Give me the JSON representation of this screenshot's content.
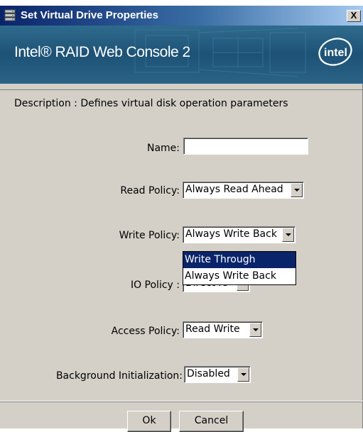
{
  "window": {
    "title": "Set Virtual Drive Properties",
    "close_glyph": "X",
    "icon": "server-stack-icon"
  },
  "banner": {
    "app_name": "Intel® RAID Web Console 2",
    "logo_text": "intel",
    "logo": "intel-logo-icon"
  },
  "description": "Description : Defines virtual disk operation parameters",
  "fields": {
    "name": {
      "label": "Name:",
      "value": ""
    },
    "read_policy": {
      "label": "Read Policy:",
      "value": "Always Read Ahead"
    },
    "write_policy": {
      "label": "Write Policy:",
      "value": "Always Write Back"
    },
    "io_policy": {
      "label": "IO Policy :",
      "value": "Direct IO"
    },
    "access_policy": {
      "label": "Access Policy:",
      "value": "Read Write"
    },
    "background_init": {
      "label": "Background Initialization:",
      "value": "Disabled"
    }
  },
  "write_policy_dropdown": {
    "options": [
      "Write Through",
      "Always Write Back"
    ],
    "highlighted_index": 0
  },
  "buttons": {
    "ok": "Ok",
    "cancel": "Cancel"
  },
  "colors": {
    "selection": "#0a246a",
    "dialog_bg": "#d4d0c8",
    "banner": "#1d5275"
  }
}
